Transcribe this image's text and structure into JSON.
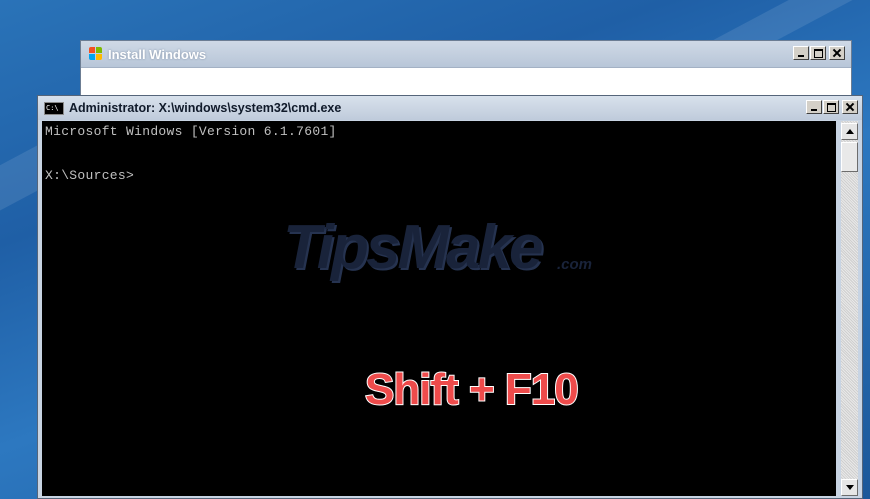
{
  "install_window": {
    "title": "Install Windows"
  },
  "cmd_window": {
    "title": "Administrator: X:\\windows\\system32\\cmd.exe",
    "icon_text": "C:\\",
    "lines": [
      "Microsoft Windows [Version 6.1.7601]",
      "",
      "X:\\Sources>"
    ]
  },
  "overlay": {
    "watermark": "TipsMake",
    "watermark_suffix": ".com",
    "shortcut": "Shift + F10"
  },
  "colors": {
    "desktop": "#2a73b8",
    "console_bg": "#000000",
    "console_text": "#c0c0c0",
    "shortcut": "#ee4b4b"
  }
}
